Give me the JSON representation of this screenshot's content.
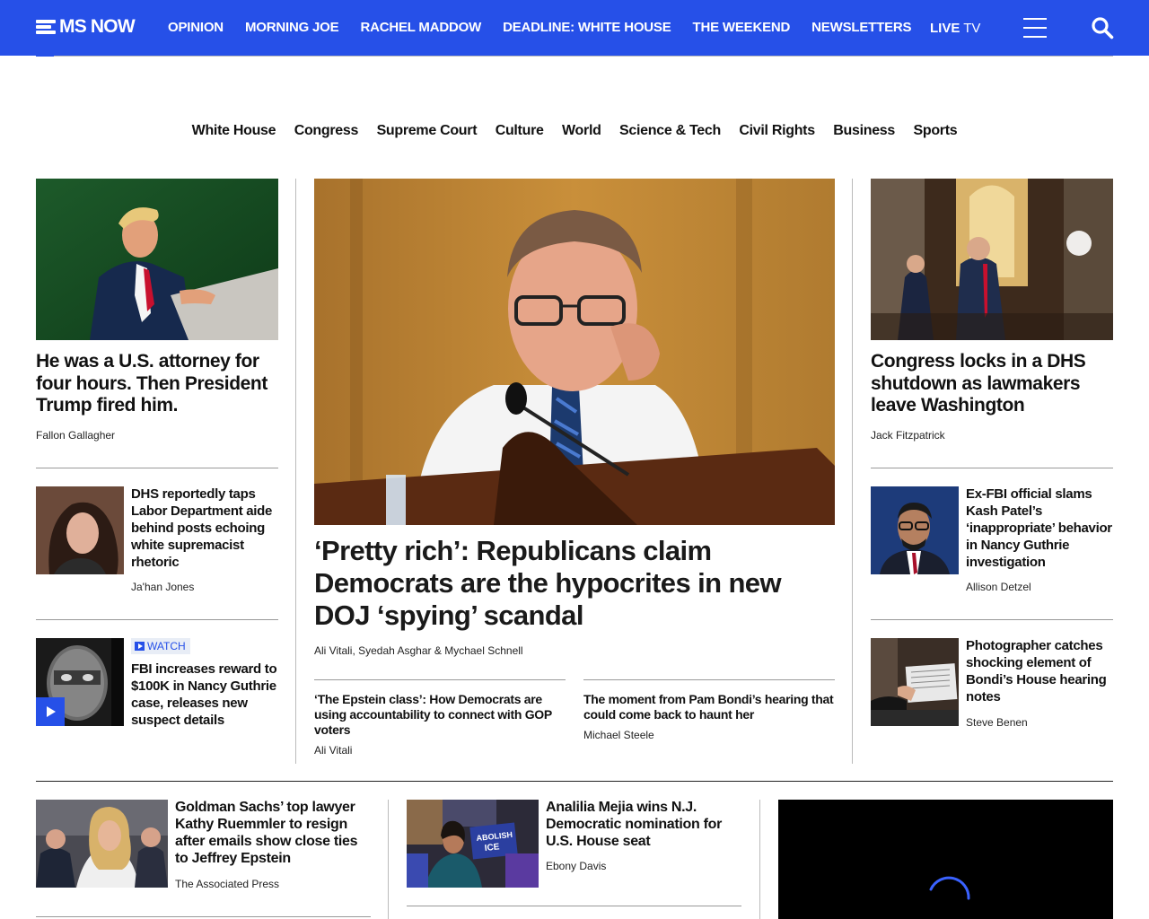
{
  "brand": {
    "name": "MS NOW",
    "accent": "#2650e8"
  },
  "nav": {
    "items": [
      "OPINION",
      "MORNING JOE",
      "RACHEL MADDOW",
      "DEADLINE: WHITE HOUSE",
      "THE WEEKEND",
      "NEWSLETTERS"
    ],
    "live_bold": "LIVE",
    "live_rest": " TV"
  },
  "sections": [
    "White House",
    "Congress",
    "Supreme Court",
    "Culture",
    "World",
    "Science & Tech",
    "Civil Rights",
    "Business",
    "Sports"
  ],
  "left": {
    "lead": {
      "headline": "He was a U.S. attorney for four hours. Then President Trump fired him.",
      "byline": "Fallon Gallagher"
    },
    "story2": {
      "headline": "DHS reportedly taps Labor Department aide behind posts echoing white supremacist rhetoric",
      "byline": "Ja'han Jones"
    },
    "story3": {
      "badge": "WATCH",
      "headline": "FBI increases reward to $100K in Nancy Guthrie case, releases new suspect details"
    }
  },
  "center": {
    "lead": {
      "headline": "‘Pretty rich’: Republicans claim Democrats are the hypocrites in new DOJ ‘spying’ scandal",
      "byline": "Ali Vitali, Syedah Asghar & Mychael Schnell"
    },
    "sub1": {
      "headline": "‘The Epstein class’: How Democrats are using accountability to connect with GOP voters",
      "byline": "Ali Vitali"
    },
    "sub2": {
      "headline": "The moment from Pam Bondi’s hearing that could come back to haunt her",
      "byline": "Michael Steele"
    }
  },
  "right": {
    "lead": {
      "headline": "Congress locks in a DHS shutdown as lawmakers leave Washington",
      "byline": "Jack Fitzpatrick"
    },
    "story2": {
      "headline": "Ex-FBI official slams Kash Patel’s ‘inappropriate’ behavior in Nancy Guthrie investigation",
      "byline": "Allison Detzel"
    },
    "story3": {
      "headline": "Photographer catches shocking element of Bondi’s House hearing notes",
      "byline": "Steve Benen"
    }
  },
  "bottom": {
    "story1": {
      "headline": "Goldman Sachs’ top lawyer Kathy Ruemmler to resign after emails show close ties to Jeffrey Epstein",
      "byline": "The Associated Press"
    },
    "story2": {
      "headline": "Analilia Mejia wins N.J. Democratic nomination for U.S. House seat",
      "byline": "Ebony Davis"
    },
    "sign_text": [
      "ABOLISH",
      "ICE"
    ]
  }
}
